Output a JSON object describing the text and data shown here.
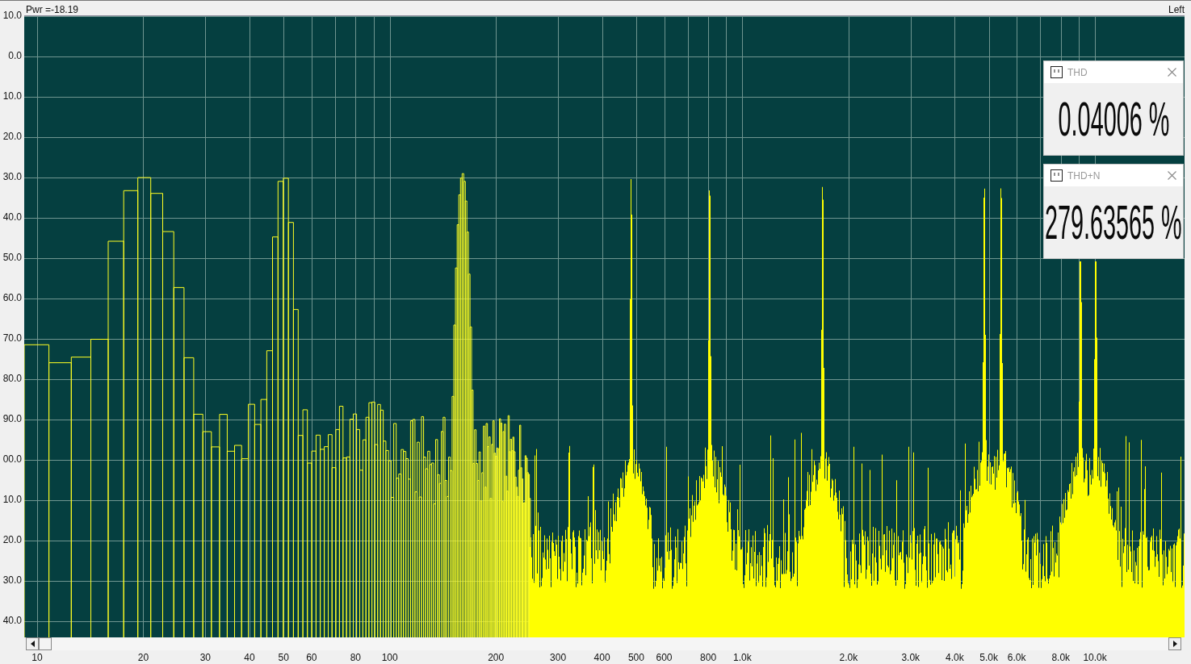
{
  "status_bar": {
    "power": "Pwr =-18.19",
    "channel": "Left"
  },
  "y_axis": {
    "labels": [
      "10.0",
      "0.0",
      "10.0",
      "20.0",
      "30.0",
      "40.0",
      "50.0",
      "60.0",
      "70.0",
      "80.0",
      "90.0",
      "00.0",
      "10.0",
      "20.0",
      "30.0",
      "40.0"
    ]
  },
  "x_axis": {
    "labels": [
      "10",
      "20",
      "30",
      "40",
      "50",
      "60",
      "80",
      "100",
      "200",
      "300",
      "400",
      "500",
      "600",
      "800",
      "1.0k",
      "2.0k",
      "3.0k",
      "4.0k",
      "5.0k",
      "6.0k",
      "8.0k",
      "10.0k"
    ]
  },
  "panels": [
    {
      "title": "THD",
      "value": "0.04006 %"
    },
    {
      "title": "THD+N",
      "value": "279.63565 %"
    }
  ]
}
